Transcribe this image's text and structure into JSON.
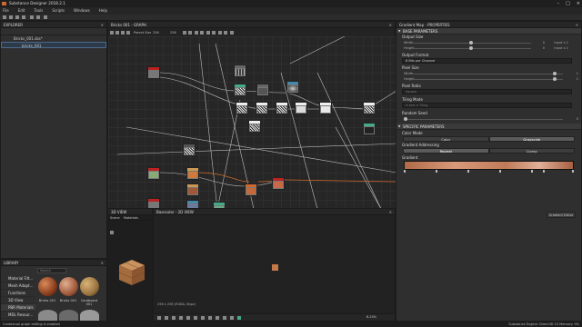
{
  "window": {
    "title": "Substance Designer 2018.2.1"
  },
  "menu": [
    "File",
    "Edit",
    "Tools",
    "Scripts",
    "Windows",
    "Help"
  ],
  "explorer": {
    "title": "EXPLORER",
    "package": "Bricks_001.sbs*",
    "graph": "bricks_001"
  },
  "library": {
    "title": "LIBRARY",
    "search_placeholder": "Search",
    "categories": [
      "Material Filt...",
      "Mesh Adapt...",
      "Functions",
      "3D View",
      "PBR Materials",
      "MDL Resour..."
    ],
    "selected_category": "PBR Materials",
    "items": [
      "Bricks 001",
      "Bricks 001",
      "Cardboard 001"
    ]
  },
  "graph": {
    "title": "Bricks 001 - GRAPH",
    "parent_size_label": "Parent Size:",
    "parent_size_value": "256",
    "size_value": "256"
  },
  "view3d": {
    "title": "3D VIEW",
    "menu": [
      "Scene",
      "Materials"
    ]
  },
  "view2d": {
    "title": "Basecolor - 2D VIEW",
    "info": "256 x 256 (RGBA, 8bpc)",
    "zoom": "6.25%"
  },
  "properties": {
    "title": "Gradient Map - PROPERTIES",
    "base_section": "BASE PARAMETERS",
    "output_size": {
      "label": "Output Size",
      "width_label": "Width",
      "height_label": "Height",
      "width_value": "0",
      "height_value": "0",
      "width_mode": "Input x 1",
      "height_mode": "Input x 1"
    },
    "output_format": {
      "label": "Output Format",
      "value": "8 Bits per Channel"
    },
    "pixel_size": {
      "label": "Pixel Size",
      "width_label": "Width",
      "height_label": "Height",
      "width_value": "1",
      "height_value": "1"
    },
    "pixel_ratio": {
      "label": "Pixel Ratio",
      "value": "Square"
    },
    "tiling_mode": {
      "label": "Tiling Mode",
      "value": "H and V Tiling"
    },
    "random_seed": {
      "label": "Random Seed",
      "value": "0"
    },
    "specific_section": "SPECIFIC PARAMETERS",
    "color_mode": {
      "label": "Color Mode",
      "options": [
        "Color",
        "Grayscale"
      ],
      "selected": "Grayscale"
    },
    "gradient_addressing": {
      "label": "Gradient Addressing",
      "options": [
        "Repeat",
        "Clamp"
      ],
      "selected": "Repeat"
    },
    "gradient": {
      "label": "Gradient",
      "editor_button": "Gradient Editor"
    }
  },
  "status": {
    "left": "Contextual graph editing is enabled",
    "right": "Substance Engine: Direct3D 10  Memory: 0%"
  },
  "colors": {
    "accent": "#d06a2c",
    "panel": "#2f2f2f"
  }
}
